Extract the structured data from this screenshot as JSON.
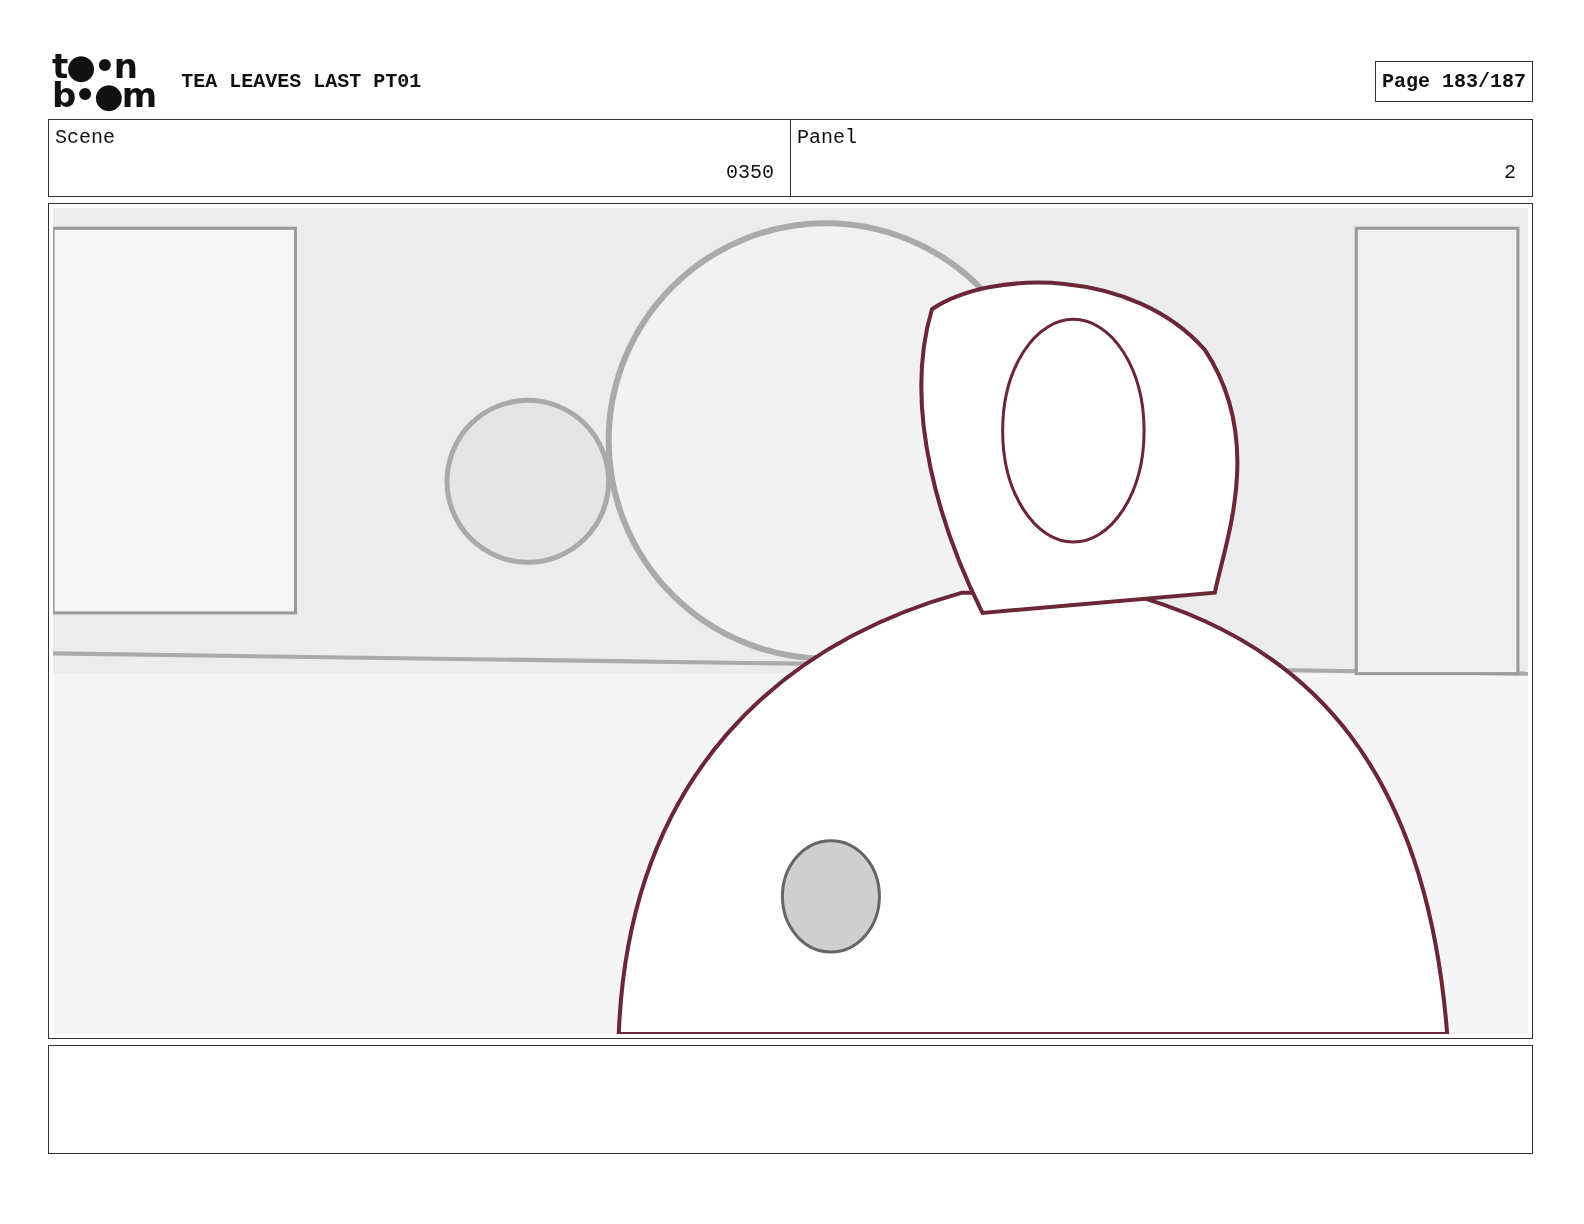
{
  "header": {
    "logo": [
      "t●•n",
      "b•●m"
    ],
    "title": "TEA LEAVES LAST PT01",
    "page": "Page 183/187"
  },
  "info": [
    {
      "label": "Scene",
      "value": "0350"
    },
    {
      "label": "Panel",
      "value": "2"
    }
  ]
}
